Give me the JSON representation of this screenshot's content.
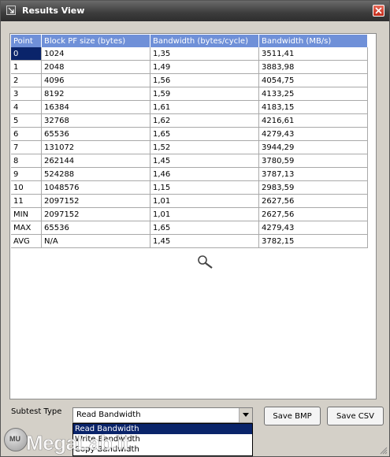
{
  "window": {
    "title": "Results View"
  },
  "table": {
    "headers": [
      "Point",
      "Block PF size (bytes)",
      "Bandwidth (bytes/cycle)",
      "Bandwidth (MB/s)"
    ],
    "rows": [
      [
        "0",
        "1024",
        "1,35",
        "3511,41"
      ],
      [
        "1",
        "2048",
        "1,49",
        "3883,98"
      ],
      [
        "2",
        "4096",
        "1,56",
        "4054,75"
      ],
      [
        "3",
        "8192",
        "1,59",
        "4133,25"
      ],
      [
        "4",
        "16384",
        "1,61",
        "4183,15"
      ],
      [
        "5",
        "32768",
        "1,62",
        "4216,61"
      ],
      [
        "6",
        "65536",
        "1,65",
        "4279,43"
      ],
      [
        "7",
        "131072",
        "1,52",
        "3944,29"
      ],
      [
        "8",
        "262144",
        "1,45",
        "3780,59"
      ],
      [
        "9",
        "524288",
        "1,46",
        "3787,13"
      ],
      [
        "10",
        "1048576",
        "1,15",
        "2983,59"
      ],
      [
        "11",
        "2097152",
        "1,01",
        "2627,56"
      ],
      [
        "MIN",
        "2097152",
        "1,01",
        "2627,56"
      ],
      [
        "MAX",
        "65536",
        "1,65",
        "4279,43"
      ],
      [
        "AVG",
        "N/A",
        "1,45",
        "3782,15"
      ]
    ],
    "selected_cell": "0"
  },
  "controls": {
    "subtest_label": "Subtest Type",
    "subtest_value": "Read Bandwidth",
    "options": [
      "Read Bandwidth",
      "Write Bandwidth",
      "Copy Bandwidth"
    ],
    "save_bmp": "Save BMP",
    "save_csv": "Save CSV"
  },
  "watermark": {
    "text": "MegaLab.it",
    "logo": "MU"
  },
  "colors": {
    "header_bg": "#6f90d8",
    "selection": "#0a246a",
    "title_bar": "#3c3c3c",
    "close": "#c02a19"
  }
}
